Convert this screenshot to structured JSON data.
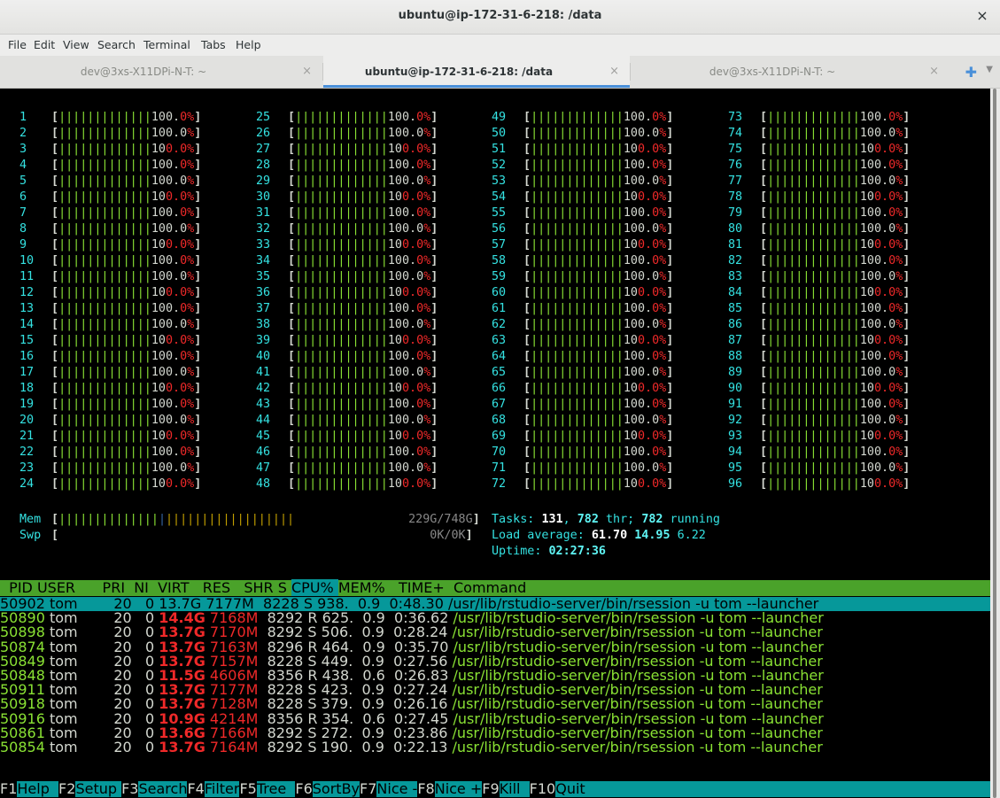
{
  "window": {
    "title": "ubuntu@ip-172-31-6-218: /data",
    "close_glyph": "×"
  },
  "menu": [
    "File",
    "Edit",
    "View",
    "Search",
    "Terminal",
    "Tabs",
    "Help"
  ],
  "tabs": [
    {
      "label": "dev@3xs-X11DPi-N-T: ~",
      "active": false
    },
    {
      "label": "ubuntu@ip-172-31-6-218: /data",
      "active": true
    },
    {
      "label": "dev@3xs-X11DPi-N-T: ~",
      "active": false
    }
  ],
  "tab_close_glyph": "×",
  "cpu_percent": "100.0%",
  "cpu_count": 96,
  "mem": {
    "label": "Mem",
    "value": "229G/748G"
  },
  "swp": {
    "label": "Swp",
    "value": "0K/0K"
  },
  "tasks": {
    "prefix": "Tasks: ",
    "tasks": "131",
    "sep1": ", ",
    "thr": "782",
    "thr_label": " thr; ",
    "running": "782",
    "running_label": " running"
  },
  "load": {
    "prefix": "Load average: ",
    "l1": "61.70",
    "l5": "14.95",
    "l15": "6.22"
  },
  "uptime": {
    "prefix": "Uptime: ",
    "value": "02:27:36"
  },
  "columns": [
    "  PID USER      PRI  NI  VIRT   RES   SHR S ",
    "CPU% ",
    "MEM%   TIME+  Command"
  ],
  "processes": [
    {
      "pid": "50902",
      "user": "tom",
      "pri": "20",
      "ni": "0",
      "virt": "13.7G",
      "res": "7177M",
      "shr": "8228",
      "s": "S",
      "cpu": "938.",
      "mem": "0.9",
      "time": "0:48.30",
      "cmd": "/usr/lib/rstudio-server/bin/rsession -u tom --launcher"
    },
    {
      "pid": "50890",
      "user": "tom",
      "pri": "20",
      "ni": "0",
      "virt": "14.4G",
      "res": "7168M",
      "shr": "8292",
      "s": "R",
      "cpu": "625.",
      "mem": "0.9",
      "time": "0:36.62",
      "cmd": "/usr/lib/rstudio-server/bin/rsession -u tom --launcher"
    },
    {
      "pid": "50898",
      "user": "tom",
      "pri": "20",
      "ni": "0",
      "virt": "13.7G",
      "res": "7170M",
      "shr": "8292",
      "s": "S",
      "cpu": "506.",
      "mem": "0.9",
      "time": "0:28.24",
      "cmd": "/usr/lib/rstudio-server/bin/rsession -u tom --launcher"
    },
    {
      "pid": "50874",
      "user": "tom",
      "pri": "20",
      "ni": "0",
      "virt": "13.7G",
      "res": "7163M",
      "shr": "8296",
      "s": "R",
      "cpu": "464.",
      "mem": "0.9",
      "time": "0:35.70",
      "cmd": "/usr/lib/rstudio-server/bin/rsession -u tom --launcher"
    },
    {
      "pid": "50849",
      "user": "tom",
      "pri": "20",
      "ni": "0",
      "virt": "13.7G",
      "res": "7157M",
      "shr": "8228",
      "s": "S",
      "cpu": "449.",
      "mem": "0.9",
      "time": "0:27.56",
      "cmd": "/usr/lib/rstudio-server/bin/rsession -u tom --launcher"
    },
    {
      "pid": "50848",
      "user": "tom",
      "pri": "20",
      "ni": "0",
      "virt": "11.5G",
      "res": "4606M",
      "shr": "8356",
      "s": "R",
      "cpu": "438.",
      "mem": "0.6",
      "time": "0:26.83",
      "cmd": "/usr/lib/rstudio-server/bin/rsession -u tom --launcher"
    },
    {
      "pid": "50911",
      "user": "tom",
      "pri": "20",
      "ni": "0",
      "virt": "13.7G",
      "res": "7177M",
      "shr": "8228",
      "s": "S",
      "cpu": "423.",
      "mem": "0.9",
      "time": "0:27.24",
      "cmd": "/usr/lib/rstudio-server/bin/rsession -u tom --launcher"
    },
    {
      "pid": "50918",
      "user": "tom",
      "pri": "20",
      "ni": "0",
      "virt": "13.7G",
      "res": "7128M",
      "shr": "8228",
      "s": "S",
      "cpu": "379.",
      "mem": "0.9",
      "time": "0:26.16",
      "cmd": "/usr/lib/rstudio-server/bin/rsession -u tom --launcher"
    },
    {
      "pid": "50916",
      "user": "tom",
      "pri": "20",
      "ni": "0",
      "virt": "10.9G",
      "res": "4214M",
      "shr": "8356",
      "s": "R",
      "cpu": "354.",
      "mem": "0.6",
      "time": "0:27.45",
      "cmd": "/usr/lib/rstudio-server/bin/rsession -u tom --launcher"
    },
    {
      "pid": "50861",
      "user": "tom",
      "pri": "20",
      "ni": "0",
      "virt": "13.6G",
      "res": "7166M",
      "shr": "8292",
      "s": "S",
      "cpu": "272.",
      "mem": "0.9",
      "time": "0:23.86",
      "cmd": "/usr/lib/rstudio-server/bin/rsession -u tom --launcher"
    },
    {
      "pid": "50854",
      "user": "tom",
      "pri": "20",
      "ni": "0",
      "virt": "13.7G",
      "res": "7164M",
      "shr": "8292",
      "s": "S",
      "cpu": "190.",
      "mem": "0.9",
      "time": "0:22.13",
      "cmd": "/usr/lib/rstudio-server/bin/rsession -u tom --launcher"
    }
  ],
  "footer": [
    {
      "key": "F1",
      "label": "Help  "
    },
    {
      "key": "F2",
      "label": "Setup "
    },
    {
      "key": "F3",
      "label": "Search"
    },
    {
      "key": "F4",
      "label": "Filter"
    },
    {
      "key": "F5",
      "label": "Tree  "
    },
    {
      "key": "F6",
      "label": "SortBy"
    },
    {
      "key": "F7",
      "label": "Nice -"
    },
    {
      "key": "F8",
      "label": "Nice +"
    },
    {
      "key": "F9",
      "label": "Kill  "
    },
    {
      "key": "F10",
      "label": "Quit"
    }
  ],
  "colors": {
    "terminal_bg": "#000000",
    "bar_green": "#8ae234",
    "bar_red": "#ef2929",
    "header_green": "#4aa22a",
    "selected_cyan": "#06989a",
    "label_cyan": "#34e2e2"
  }
}
